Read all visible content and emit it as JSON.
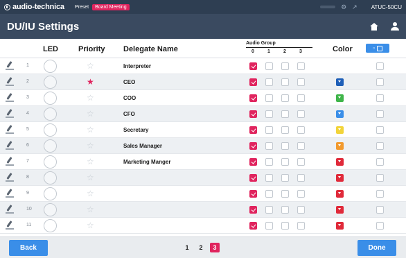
{
  "brand": {
    "name": "audio-technica",
    "preset_label": "Preset",
    "meeting_label": "Board Meeting",
    "model": "ATUC-50CU"
  },
  "header": {
    "title": "DU/IU Settings"
  },
  "columns": {
    "led": "LED",
    "priority": "Priority",
    "delegate_name": "Delegate Name",
    "audio_group": "Audio Group",
    "audio_group_numbers": [
      "0",
      "1",
      "2",
      "3"
    ],
    "color": "Color"
  },
  "colors": {
    "accent": "#e0245e",
    "button": "#3a8ee8",
    "header_bg": "#3a4a60"
  },
  "rows": [
    {
      "num": "1",
      "name": "Interpreter",
      "priority": false,
      "groups": [
        true,
        false,
        false,
        false
      ],
      "color": null
    },
    {
      "num": "2",
      "name": "CEO",
      "priority": true,
      "groups": [
        true,
        false,
        false,
        false
      ],
      "color": "#1f5fb8"
    },
    {
      "num": "3",
      "name": "COO",
      "priority": false,
      "groups": [
        true,
        false,
        false,
        false
      ],
      "color": "#3fb54a"
    },
    {
      "num": "4",
      "name": "CFO",
      "priority": false,
      "groups": [
        true,
        false,
        false,
        false
      ],
      "color": "#3a8ee8"
    },
    {
      "num": "5",
      "name": "Secretary",
      "priority": false,
      "groups": [
        true,
        false,
        false,
        false
      ],
      "color": "#f2d43a"
    },
    {
      "num": "6",
      "name": "Sales Manager",
      "priority": false,
      "groups": [
        true,
        false,
        false,
        false
      ],
      "color": "#f29a2e"
    },
    {
      "num": "7",
      "name": "Marketing Manger",
      "priority": false,
      "groups": [
        true,
        false,
        false,
        false
      ],
      "color": "#e02a3a"
    },
    {
      "num": "8",
      "name": "",
      "priority": false,
      "groups": [
        true,
        false,
        false,
        false
      ],
      "color": "#e02a3a"
    },
    {
      "num": "9",
      "name": "",
      "priority": false,
      "groups": [
        true,
        false,
        false,
        false
      ],
      "color": "#e02a3a"
    },
    {
      "num": "10",
      "name": "",
      "priority": false,
      "groups": [
        true,
        false,
        false,
        false
      ],
      "color": "#e02a3a"
    },
    {
      "num": "11",
      "name": "",
      "priority": false,
      "groups": [
        true,
        false,
        false,
        false
      ],
      "color": "#e02a3a"
    }
  ],
  "footer": {
    "back_label": "Back",
    "done_label": "Done",
    "pages": [
      "1",
      "2",
      "3"
    ],
    "active_page": "3"
  }
}
